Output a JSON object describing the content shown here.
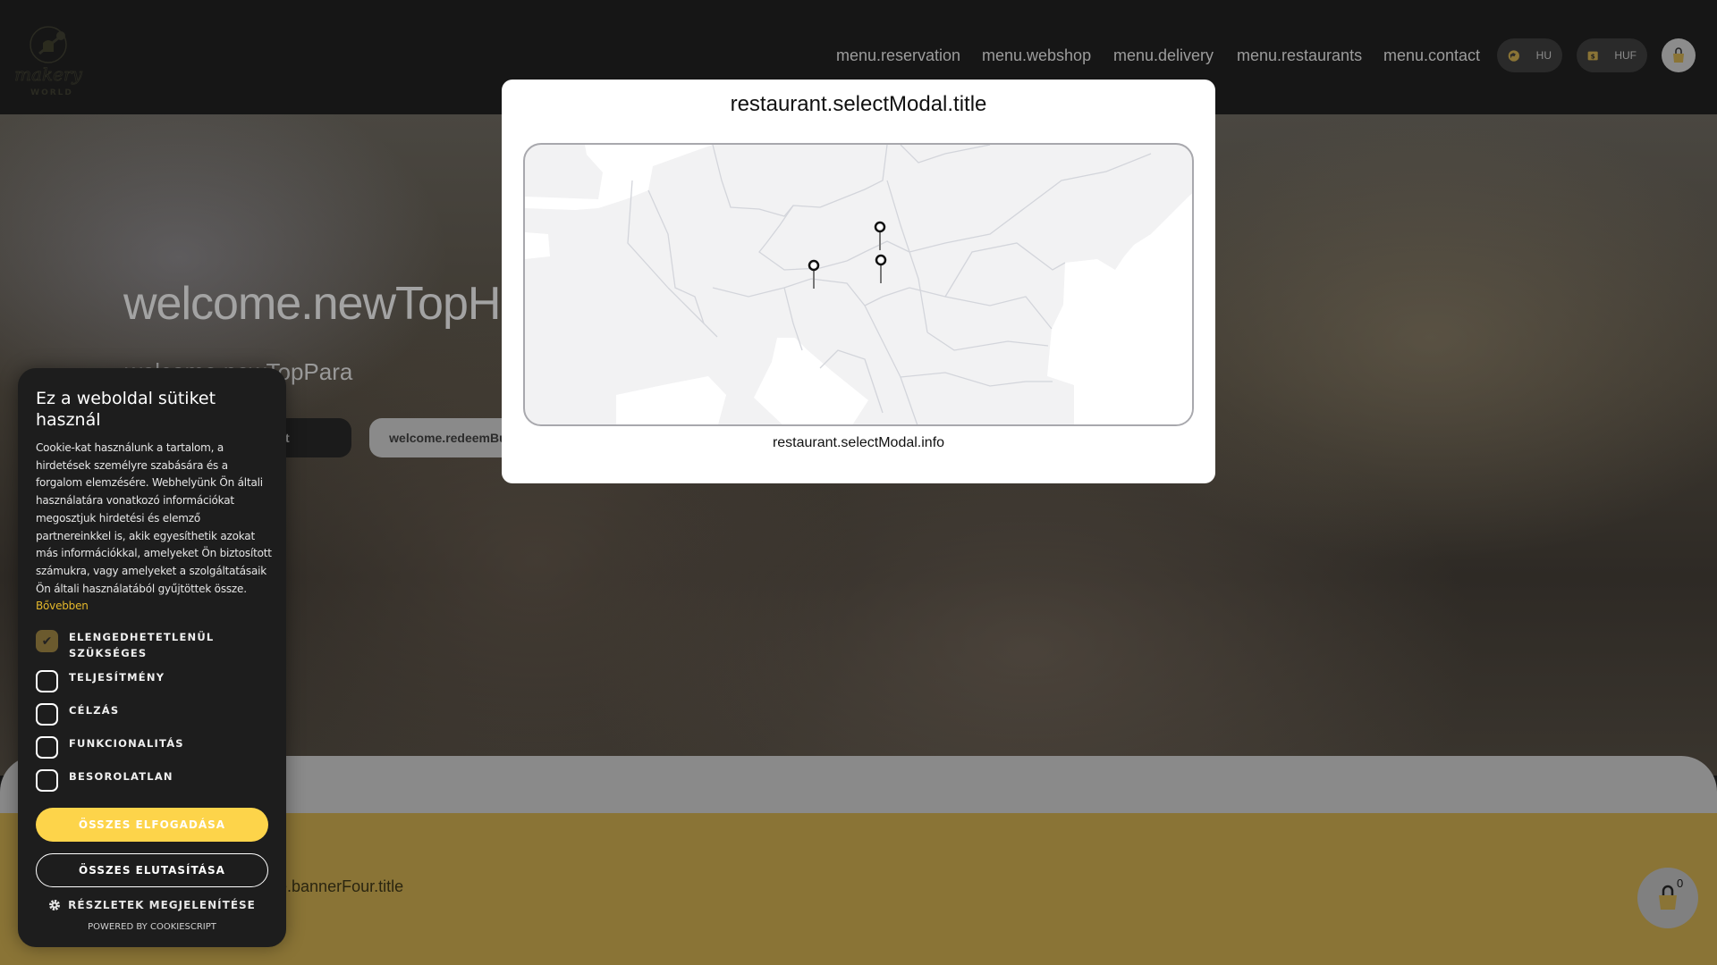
{
  "header": {
    "logo_text": "makery WORLD",
    "nav": [
      "menu.reservation",
      "menu.webshop",
      "menu.delivery",
      "menu.restaurants",
      "menu.contact"
    ],
    "language": "HU",
    "currency": "HUF"
  },
  "hero": {
    "title": "welcome.newTopHeader",
    "para": "welcome.newTopPara",
    "button1": "welcome.buttonText",
    "button2": "welcome.redeemButtonText"
  },
  "banner_four_title": "welcome.bannerFour.title",
  "cart": {
    "count": "0"
  },
  "modal": {
    "title": "restaurant.selectModal.title",
    "info": "restaurant.selectModal.info"
  },
  "cookie": {
    "title": "Ez a weboldal sütiket használ",
    "text": "Cookie-kat használunk a tartalom, a hirdetések személyre szabására és a forgalom elemzésére. Webhelyünk Ön általi használatára vonatkozó információkat megosztjuk hirdetési és elemző partnereinkkel is, akik egyesíthetik azokat más információkkal, amelyeket Ön biztosított számukra, vagy amelyeket a szolgáltatásaik Ön általi használatából gyűjtöttek össze.",
    "more": "Bővebben",
    "items": [
      {
        "label": "ELENGEDHETETLENÜL SZÜKSÉGES",
        "checked": true
      },
      {
        "label": "TELJESÍTMÉNY",
        "checked": false
      },
      {
        "label": "CÉLZÁS",
        "checked": false
      },
      {
        "label": "FUNKCIONALITÁS",
        "checked": false
      },
      {
        "label": "BESOROLATLAN",
        "checked": false
      }
    ],
    "accept": "ÖSSZES ELFOGADÁSA",
    "reject": "ÖSSZES ELUTASÍTÁSA",
    "details": "RÉSZLETEK MEGJELENÍTÉSE",
    "powered": "POWERED BY COOKIESCRIPT"
  },
  "colors": {
    "accent": "#fdd44a",
    "gold_band": "#8a7436",
    "header": "#161616"
  }
}
